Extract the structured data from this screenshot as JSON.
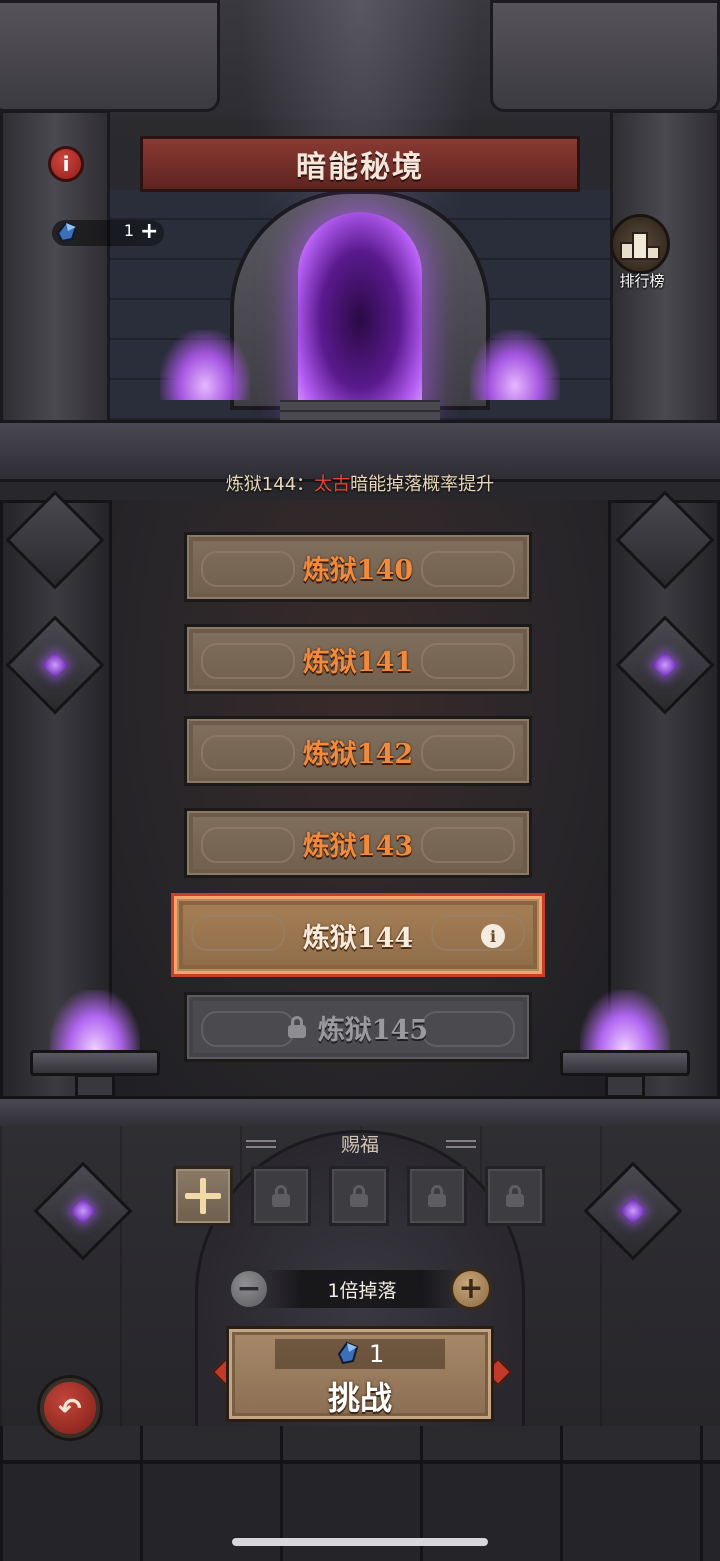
{
  "header": {
    "title": "暗能秘境",
    "ticket_count": "1",
    "ticket_plus": "+",
    "info_glyph": "i",
    "ranking_label": "排行榜"
  },
  "notice": {
    "prefix": "炼狱144：",
    "highlight": "太古",
    "suffix": "暗能掉落概率提升",
    "highlight_color": "#e6463a"
  },
  "levels": [
    {
      "label": "炼狱140",
      "state": "normal"
    },
    {
      "label": "炼狱141",
      "state": "normal"
    },
    {
      "label": "炼狱142",
      "state": "normal"
    },
    {
      "label": "炼狱143",
      "state": "normal"
    },
    {
      "label": "炼狱144",
      "state": "selected",
      "info_glyph": "i"
    },
    {
      "label": "炼狱145",
      "state": "locked"
    }
  ],
  "blessing": {
    "title": "赐福",
    "slots": [
      "add",
      "locked",
      "locked",
      "locked",
      "locked"
    ]
  },
  "multiplier": {
    "label": "1倍掉落",
    "minus": "−",
    "plus": "+"
  },
  "challenge": {
    "cost": "1",
    "label": "挑战"
  },
  "back": {
    "glyph": "↶"
  },
  "icons": {
    "info": "info-icon",
    "ticket": "crystal-ticket-icon",
    "ranking": "podium-icon",
    "lock": "lock-icon",
    "back": "back-arrow-icon"
  },
  "colors": {
    "accent_orange": "#f08a3c",
    "portal_purple": "#b35cf2",
    "selected_border": "#f4a46a"
  }
}
